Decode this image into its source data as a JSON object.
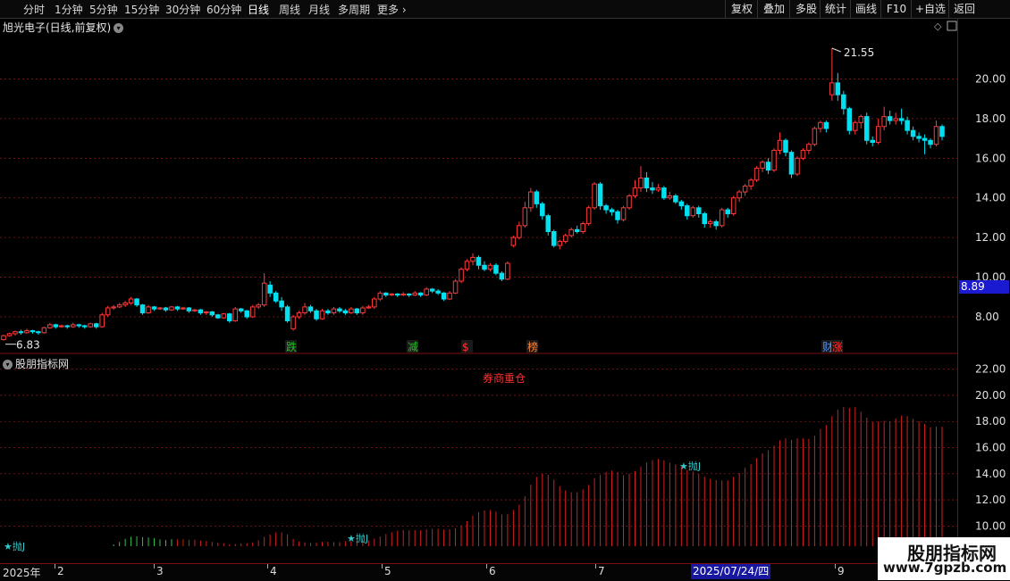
{
  "toolbar": {
    "periods": [
      "分时",
      "1分钟",
      "5分钟",
      "15分钟",
      "30分钟",
      "60分钟",
      "日线",
      "周线",
      "月线",
      "多周期",
      "更多"
    ],
    "active_period": "日线",
    "right_buttons": [
      "复权",
      "叠加",
      "多股",
      "统计",
      "画线",
      "F10",
      "+自选",
      "返回"
    ]
  },
  "title": {
    "stock": "旭光电子(日线,前复权)"
  },
  "indicator": {
    "name": "股朋指标网",
    "annotation": "券商重仓"
  },
  "markers": {
    "high_label": "21.55",
    "low_label": "6.83",
    "events": [
      {
        "text": "跌",
        "color": "#20c020"
      },
      {
        "text": "减",
        "color": "#20c020"
      },
      {
        "text": "$",
        "color": "#ff3030"
      },
      {
        "text": "榜",
        "color": "#ff8030"
      },
      {
        "text": "财",
        "color": "#5090ff"
      },
      {
        "text": "涨",
        "color": "#ff3030"
      }
    ],
    "signals": [
      "抛J",
      "抛J",
      "抛J"
    ]
  },
  "current_price": "8.89",
  "dates": {
    "labels": [
      "2025年",
      "2",
      "3",
      "4",
      "5",
      "6",
      "7",
      "9"
    ],
    "selected": "2025/07/24/四"
  },
  "watermark": {
    "line1": "股朋指标网",
    "line2": "www.7gpzb.com"
  },
  "colors": {
    "up": "#ff3a3a",
    "down": "#00e0f0",
    "grid": "#8a1818",
    "axis_text": "#e0e0e0"
  },
  "chart_data": [
    {
      "type": "candlestick",
      "title": "旭光电子(日线,前复权)",
      "y_ticks": [
        8.0,
        10.0,
        12.0,
        14.0,
        16.0,
        18.0,
        20.0
      ],
      "ylim": [
        6.2,
        22.0
      ],
      "series": [
        {
          "values": [
            [
              6.85,
              7.05,
              6.8,
              7.1
            ],
            [
              7.05,
              7.15,
              7.0,
              7.2
            ],
            [
              7.15,
              7.25,
              7.05,
              7.3
            ],
            [
              7.25,
              7.2,
              7.1,
              7.35
            ],
            [
              7.2,
              7.3,
              7.15,
              7.4
            ],
            [
              7.3,
              7.25,
              7.15,
              7.35
            ],
            [
              7.25,
              7.2,
              7.1,
              7.3
            ],
            [
              7.2,
              7.45,
              7.15,
              7.5
            ],
            [
              7.45,
              7.6,
              7.4,
              7.7
            ],
            [
              7.6,
              7.5,
              7.4,
              7.65
            ],
            [
              7.5,
              7.55,
              7.45,
              7.6
            ],
            [
              7.55,
              7.5,
              7.4,
              7.6
            ],
            [
              7.5,
              7.6,
              7.45,
              7.7
            ],
            [
              7.6,
              7.55,
              7.45,
              7.65
            ],
            [
              7.55,
              7.5,
              7.4,
              7.6
            ],
            [
              7.5,
              7.65,
              7.45,
              7.7
            ],
            [
              7.65,
              7.5,
              7.4,
              7.7
            ],
            [
              7.5,
              8.1,
              7.45,
              8.2
            ],
            [
              8.1,
              8.45,
              8.0,
              8.55
            ],
            [
              8.45,
              8.5,
              8.35,
              8.6
            ],
            [
              8.5,
              8.6,
              8.45,
              8.7
            ],
            [
              8.6,
              8.7,
              8.5,
              8.8
            ],
            [
              8.7,
              8.9,
              8.6,
              9.0
            ],
            [
              8.9,
              8.6,
              8.5,
              8.95
            ],
            [
              8.6,
              8.2,
              8.1,
              8.65
            ],
            [
              8.2,
              8.5,
              8.15,
              8.6
            ],
            [
              8.5,
              8.4,
              8.3,
              8.55
            ],
            [
              8.4,
              8.45,
              8.35,
              8.5
            ],
            [
              8.45,
              8.35,
              8.25,
              8.5
            ],
            [
              8.35,
              8.5,
              8.3,
              8.55
            ],
            [
              8.5,
              8.4,
              8.3,
              8.55
            ],
            [
              8.4,
              8.45,
              8.35,
              8.5
            ],
            [
              8.45,
              8.3,
              8.2,
              8.5
            ],
            [
              8.3,
              8.35,
              8.25,
              8.4
            ],
            [
              8.35,
              8.2,
              8.1,
              8.4
            ],
            [
              8.2,
              8.25,
              8.1,
              8.3
            ],
            [
              8.25,
              8.1,
              8.0,
              8.3
            ],
            [
              8.1,
              7.95,
              7.9,
              8.15
            ],
            [
              7.95,
              8.15,
              7.9,
              8.2
            ],
            [
              8.15,
              7.8,
              7.7,
              8.2
            ],
            [
              7.8,
              8.4,
              7.75,
              8.5
            ],
            [
              8.4,
              8.3,
              8.2,
              8.45
            ],
            [
              8.3,
              8.0,
              7.9,
              8.35
            ],
            [
              8.0,
              8.5,
              7.95,
              8.6
            ],
            [
              8.5,
              8.6,
              8.4,
              8.7
            ],
            [
              8.6,
              9.7,
              8.5,
              10.2
            ],
            [
              9.6,
              9.2,
              9.0,
              9.8
            ],
            [
              9.2,
              8.8,
              8.7,
              9.3
            ],
            [
              8.8,
              8.5,
              8.3,
              9.0
            ],
            [
              8.5,
              7.8,
              7.7,
              8.6
            ],
            [
              7.4,
              8.0,
              7.3,
              8.1
            ],
            [
              8.0,
              8.2,
              7.9,
              8.3
            ],
            [
              8.2,
              8.5,
              8.1,
              8.7
            ],
            [
              8.5,
              8.3,
              8.2,
              8.6
            ],
            [
              8.3,
              7.9,
              7.8,
              8.4
            ],
            [
              7.9,
              8.3,
              7.85,
              8.4
            ],
            [
              8.3,
              8.2,
              8.1,
              8.4
            ],
            [
              8.2,
              8.4,
              8.1,
              8.5
            ],
            [
              8.4,
              8.3,
              8.2,
              8.5
            ],
            [
              8.3,
              8.2,
              8.1,
              8.4
            ],
            [
              8.2,
              8.4,
              8.15,
              8.5
            ],
            [
              8.4,
              8.2,
              8.1,
              8.45
            ],
            [
              8.2,
              8.45,
              8.1,
              8.55
            ],
            [
              8.45,
              8.5,
              8.4,
              8.6
            ],
            [
              8.5,
              8.9,
              8.4,
              9.0
            ],
            [
              8.9,
              9.2,
              8.8,
              9.3
            ],
            [
              9.2,
              9.1,
              9.0,
              9.25
            ],
            [
              9.1,
              9.15,
              9.05,
              9.2
            ],
            [
              9.15,
              9.1,
              9.0,
              9.2
            ],
            [
              9.1,
              9.15,
              9.05,
              9.25
            ],
            [
              9.15,
              9.1,
              9.0,
              9.2
            ],
            [
              9.1,
              9.2,
              9.05,
              9.3
            ],
            [
              9.2,
              9.1,
              9.0,
              9.25
            ],
            [
              9.1,
              9.4,
              9.05,
              9.5
            ],
            [
              9.4,
              9.3,
              9.2,
              9.45
            ],
            [
              9.3,
              9.2,
              9.1,
              9.4
            ],
            [
              9.2,
              8.9,
              8.8,
              9.25
            ],
            [
              8.9,
              9.2,
              8.85,
              9.3
            ],
            [
              9.2,
              9.8,
              9.15,
              9.9
            ],
            [
              9.8,
              10.4,
              9.7,
              10.5
            ],
            [
              10.4,
              10.8,
              10.3,
              10.9
            ],
            [
              10.8,
              11.0,
              10.6,
              11.2
            ],
            [
              11.0,
              10.6,
              10.4,
              11.1
            ],
            [
              10.6,
              10.4,
              10.3,
              10.8
            ],
            [
              10.4,
              10.6,
              10.3,
              10.7
            ],
            [
              10.6,
              10.2,
              10.1,
              10.7
            ],
            [
              10.2,
              9.9,
              9.8,
              10.3
            ],
            [
              9.9,
              10.7,
              9.85,
              10.8
            ],
            [
              11.6,
              12.0,
              11.5,
              12.1
            ],
            [
              12.0,
              12.6,
              11.9,
              12.8
            ],
            [
              12.6,
              13.5,
              12.5,
              13.8
            ],
            [
              13.5,
              14.3,
              13.3,
              14.5
            ],
            [
              14.3,
              13.7,
              13.5,
              14.4
            ],
            [
              13.7,
              13.1,
              12.9,
              13.8
            ],
            [
              13.1,
              12.3,
              12.1,
              13.2
            ],
            [
              12.3,
              11.6,
              11.5,
              12.4
            ],
            [
              11.6,
              11.8,
              11.4,
              11.9
            ],
            [
              11.8,
              12.1,
              11.7,
              12.2
            ],
            [
              12.1,
              12.4,
              12.0,
              12.5
            ],
            [
              12.4,
              12.3,
              12.2,
              12.6
            ],
            [
              12.3,
              12.7,
              12.2,
              12.8
            ],
            [
              12.7,
              13.5,
              12.6,
              13.6
            ],
            [
              13.5,
              14.7,
              13.4,
              14.8
            ],
            [
              14.7,
              13.6,
              13.4,
              14.8
            ],
            [
              13.6,
              13.4,
              13.2,
              13.7
            ],
            [
              13.4,
              13.3,
              13.1,
              13.5
            ],
            [
              13.3,
              12.9,
              12.7,
              13.4
            ],
            [
              12.9,
              13.5,
              12.8,
              13.6
            ],
            [
              13.5,
              14.1,
              13.4,
              14.2
            ],
            [
              14.1,
              14.5,
              14.0,
              14.9
            ],
            [
              14.5,
              15.0,
              14.3,
              15.6
            ],
            [
              15.0,
              14.5,
              14.3,
              15.3
            ],
            [
              14.5,
              14.4,
              14.2,
              14.8
            ],
            [
              14.4,
              14.5,
              14.3,
              14.7
            ],
            [
              14.5,
              14.0,
              13.9,
              14.6
            ],
            [
              14.0,
              14.1,
              13.9,
              14.3
            ],
            [
              14.1,
              13.8,
              13.7,
              14.2
            ],
            [
              13.8,
              13.6,
              13.4,
              13.9
            ],
            [
              13.6,
              13.1,
              12.9,
              13.7
            ],
            [
              13.1,
              13.5,
              13.0,
              13.6
            ],
            [
              13.5,
              13.2,
              13.0,
              13.6
            ],
            [
              13.2,
              12.7,
              12.5,
              13.3
            ],
            [
              12.7,
              12.8,
              12.5,
              12.9
            ],
            [
              12.8,
              12.6,
              12.4,
              12.9
            ],
            [
              12.6,
              13.4,
              12.5,
              13.5
            ],
            [
              13.4,
              13.2,
              13.0,
              13.5
            ],
            [
              13.2,
              14.0,
              13.1,
              14.1
            ],
            [
              14.0,
              14.3,
              13.8,
              14.4
            ],
            [
              14.3,
              14.6,
              14.1,
              14.7
            ],
            [
              14.6,
              14.9,
              14.4,
              15.0
            ],
            [
              14.9,
              15.5,
              14.8,
              15.6
            ],
            [
              15.5,
              15.8,
              15.3,
              15.9
            ],
            [
              15.8,
              15.4,
              15.2,
              16.0
            ],
            [
              15.4,
              16.4,
              15.3,
              16.5
            ],
            [
              16.4,
              16.9,
              16.2,
              17.3
            ],
            [
              16.9,
              16.3,
              16.1,
              17.0
            ],
            [
              16.3,
              15.2,
              15.0,
              16.4
            ],
            [
              15.2,
              16.0,
              15.1,
              16.1
            ],
            [
              16.0,
              16.4,
              15.9,
              16.5
            ],
            [
              16.4,
              16.7,
              16.2,
              16.8
            ],
            [
              16.7,
              17.5,
              16.6,
              17.6
            ],
            [
              17.5,
              17.8,
              17.3,
              17.9
            ],
            [
              17.8,
              17.5,
              17.3,
              17.9
            ],
            [
              19.2,
              19.8,
              18.9,
              21.55
            ],
            [
              19.8,
              19.2,
              18.9,
              20.3
            ],
            [
              19.2,
              18.5,
              18.2,
              19.4
            ],
            [
              18.5,
              17.4,
              17.2,
              18.6
            ],
            [
              17.4,
              17.8,
              17.2,
              17.9
            ],
            [
              17.8,
              18.1,
              17.5,
              18.2
            ],
            [
              18.1,
              16.9,
              16.7,
              18.3
            ],
            [
              16.9,
              16.8,
              16.6,
              17.1
            ],
            [
              16.8,
              17.6,
              16.7,
              18.0
            ],
            [
              17.6,
              18.1,
              17.4,
              18.6
            ],
            [
              18.1,
              17.9,
              17.7,
              18.4
            ],
            [
              17.9,
              18.0,
              17.7,
              18.3
            ],
            [
              18.0,
              17.9,
              17.7,
              18.5
            ],
            [
              17.9,
              17.4,
              17.2,
              18.1
            ],
            [
              17.4,
              17.1,
              16.9,
              17.6
            ],
            [
              17.1,
              17.0,
              16.8,
              17.3
            ],
            [
              17.0,
              16.9,
              16.2,
              17.2
            ],
            [
              16.9,
              16.7,
              16.5,
              17.0
            ],
            [
              16.7,
              17.6,
              16.6,
              17.9
            ],
            [
              17.6,
              17.1,
              16.9,
              17.7
            ]
          ]
        }
      ]
    },
    {
      "type": "bar",
      "title": "股朋指标网",
      "y_ticks": [
        10.0,
        12.0,
        14.0,
        16.0,
        18.0,
        20.0,
        22.0
      ],
      "ylim": [
        9.0,
        23.0
      ]
    }
  ]
}
